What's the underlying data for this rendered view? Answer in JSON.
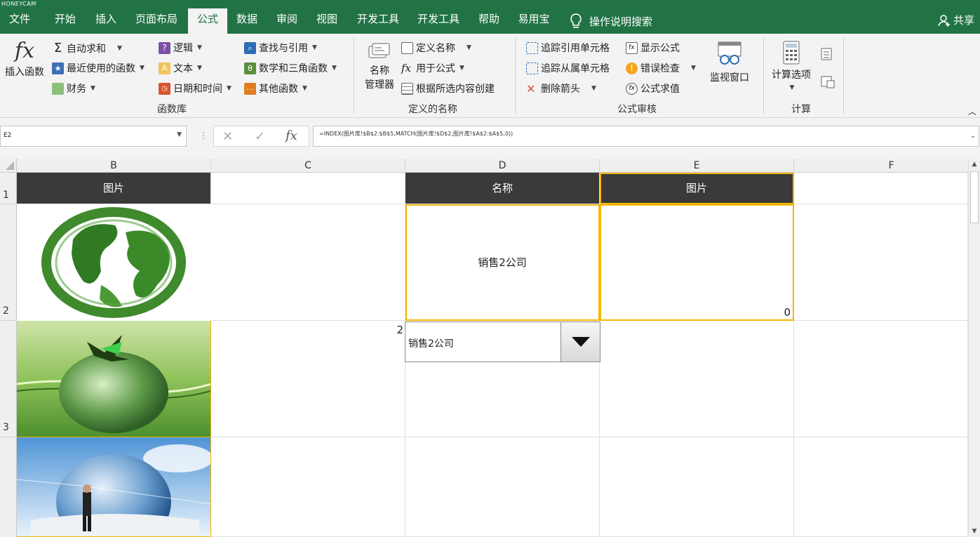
{
  "watermark": "HONEYCAM",
  "tabs": [
    "文件",
    "开始",
    "插入",
    "页面布局",
    "公式",
    "数据",
    "审阅",
    "视图",
    "开发工具",
    "开发工具",
    "帮助",
    "易用宝"
  ],
  "active_tab": "公式",
  "tell_me": "操作说明搜索",
  "share": "共享",
  "ribbon": {
    "insert_function": "插入函数",
    "autosum": "自动求和",
    "recent": "最近使用的函数",
    "financial": "财务",
    "logical": "逻辑",
    "text": "文本",
    "datetime": "日期和时间",
    "lookup": "查找与引用",
    "math": "数学和三角函数",
    "other": "其他函数",
    "group_library": "函数库",
    "name_manager_1": "名称",
    "name_manager_2": "管理器",
    "define_name": "定义名称",
    "use_in_formula": "用于公式",
    "create_from_sel": "根据所选内容创建",
    "group_names": "定义的名称",
    "trace_precedents": "追踪引用单元格",
    "trace_dependents": "追踪从属单元格",
    "remove_arrows": "删除箭头",
    "show_formulas": "显示公式",
    "error_checking": "错误检查",
    "evaluate": "公式求值",
    "watch_window": "监视窗口",
    "group_audit": "公式审核",
    "calc_options": "计算选项",
    "group_calc": "计算"
  },
  "name_box": "E2",
  "formula": "=INDEX(图片库!$B$2:$B$5,MATCH(图片库!$D$2,图片库!$A$2:$A$5,0))",
  "columns": [
    "B",
    "C",
    "D",
    "E",
    "F"
  ],
  "rows": [
    "1",
    "2",
    "3"
  ],
  "headers": {
    "b1": "图片",
    "d1": "名称",
    "e1": "图片"
  },
  "cells": {
    "d2": "销售2公司",
    "e2": "0",
    "c3": "2"
  },
  "dropdown": {
    "value": "销售2公司"
  },
  "colors": {
    "excel_green": "#217346",
    "header_dark": "#3a3a3a",
    "selection_gold": "#f2b705"
  }
}
